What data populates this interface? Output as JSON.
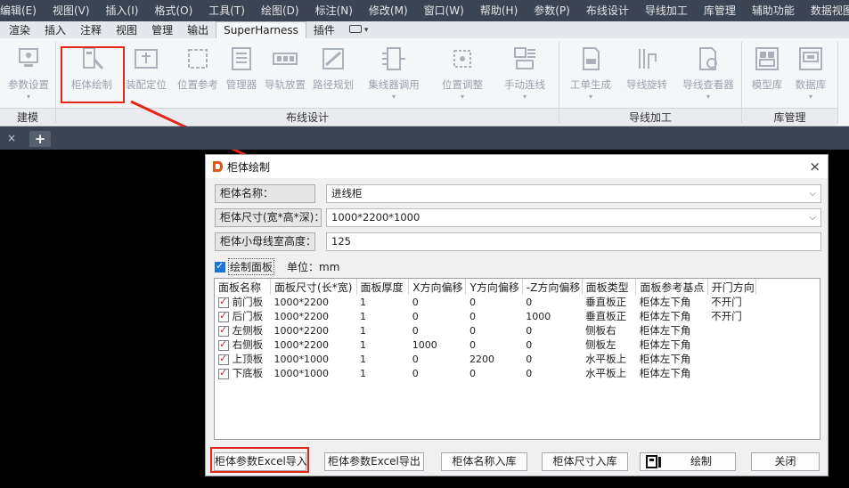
{
  "menubar": {
    "items": [
      "编辑(E)",
      "视图(V)",
      "插入(I)",
      "格式(O)",
      "工具(T)",
      "绘图(D)",
      "标注(N)",
      "修改(M)",
      "窗口(W)",
      "帮助(H)",
      "参数(P)",
      "布线设计",
      "导线加工",
      "库管理",
      "辅助功能",
      "数据视图"
    ]
  },
  "ribbon_tabs": {
    "items": [
      "渲染",
      "插入",
      "注释",
      "视图",
      "管理",
      "输出",
      "SuperHarness",
      "插件"
    ],
    "active": "SuperHarness",
    "extra_caret": "▾"
  },
  "ribbon": {
    "buttons": [
      "参数设置",
      "柜体绘制",
      "装配定位",
      "位置参考",
      "管理器",
      "导轨放置",
      "路径规划",
      "集线器调用",
      "位置调整",
      "手动连线",
      "工单生成",
      "导线旋转",
      "导线查看器",
      "模型库",
      "数据库"
    ],
    "caret": "▾",
    "groups": [
      "建模",
      "布线设计",
      "导线加工",
      "库管理"
    ]
  },
  "doc_tabs": {
    "close": "×",
    "add": "+"
  },
  "dialog": {
    "title": "柜体绘制",
    "close": "×",
    "cabinet_name_label": "柜体名称：",
    "cabinet_name_value": "进线柜",
    "cabinet_size_label": "柜体尺寸(宽*高*深)：",
    "cabinet_size_value": "1000*2200*1000",
    "busbar_height_label": "柜体小母线室高度：",
    "busbar_height_value": "125",
    "draw_panel_label": "绘制面板",
    "unit_label": "单位：mm",
    "dropdown_caret": "⌵",
    "check_mark": "✓"
  },
  "panel_table": {
    "headers": [
      "面板名称",
      "面板尺寸(长*宽)",
      "面板厚度",
      "X方向偏移",
      "Y方向偏移",
      "-Z方向偏移",
      "面板类型",
      "面板参考基点",
      "开门方向"
    ],
    "rows": [
      [
        "前门板",
        "1000*2200",
        "1",
        "0",
        "0",
        "0",
        "垂直板正",
        "柜体左下角",
        "不开门"
      ],
      [
        "后门板",
        "1000*2200",
        "1",
        "0",
        "0",
        "1000",
        "垂直板正",
        "柜体左下角",
        "不开门"
      ],
      [
        "左侧板",
        "1000*2200",
        "1",
        "0",
        "0",
        "0",
        "侧板右",
        "柜体左下角",
        ""
      ],
      [
        "右侧板",
        "1000*2200",
        "1",
        "1000",
        "0",
        "0",
        "侧板左",
        "柜体左下角",
        ""
      ],
      [
        "上顶板",
        "1000*1000",
        "1",
        "0",
        "2200",
        "0",
        "水平板上",
        "柜体左下角",
        ""
      ],
      [
        "下底板",
        "1000*1000",
        "1",
        "0",
        "0",
        "0",
        "水平板上",
        "柜体左下角",
        ""
      ]
    ]
  },
  "buttons": {
    "excel_import": "柜体参数Excel导入",
    "excel_export": "柜体参数Excel导出",
    "name_save": "柜体名称入库",
    "size_save": "柜体尺寸入库",
    "draw": "绘制",
    "close": "关闭"
  },
  "colors": {
    "accent": "#1a73d9",
    "highlight": "#e3251a",
    "menubar": "#3b4453"
  }
}
